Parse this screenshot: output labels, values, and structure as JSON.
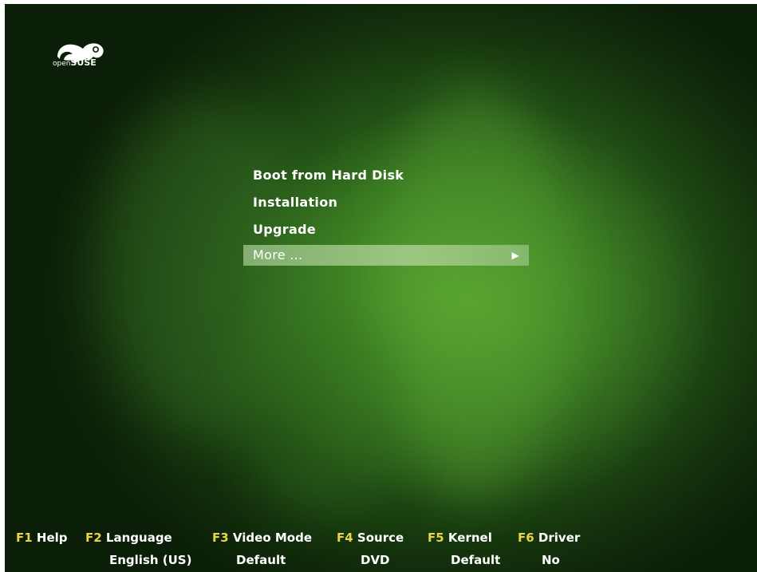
{
  "logo": {
    "text_light": "open",
    "text_bold": "SUSE"
  },
  "menu": {
    "items": [
      {
        "label": "Boot from Hard Disk"
      },
      {
        "label": "Installation"
      },
      {
        "label": "Upgrade"
      },
      {
        "label": "More ...",
        "arrow": "▶",
        "selected": true
      }
    ]
  },
  "fkeys": [
    {
      "key": "F1",
      "label": "Help",
      "value": ""
    },
    {
      "key": "F2",
      "label": "Language",
      "value": "English (US)"
    },
    {
      "key": "F3",
      "label": "Video Mode",
      "value": "Default"
    },
    {
      "key": "F4",
      "label": "Source",
      "value": "DVD"
    },
    {
      "key": "F5",
      "label": "Kernel",
      "value": "Default"
    },
    {
      "key": "F6",
      "label": "Driver",
      "value": "No"
    }
  ],
  "colors": {
    "fkey_accent": "#e8d34a",
    "background_green": "#2e6a1c",
    "selection": "#a8cc90"
  }
}
